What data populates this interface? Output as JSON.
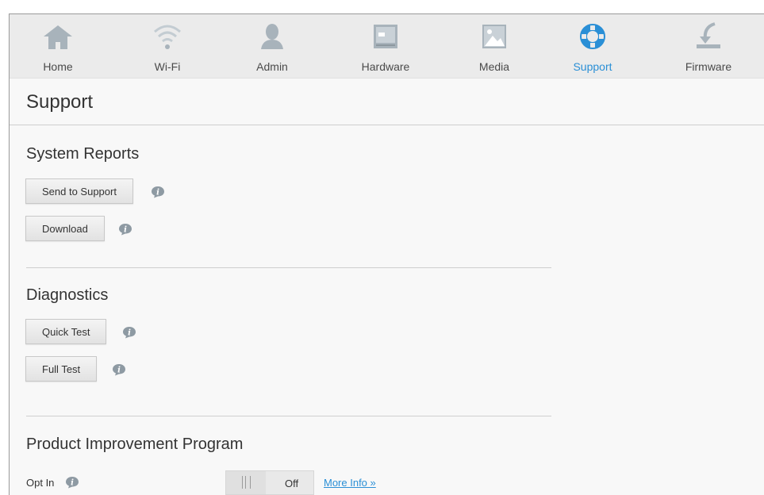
{
  "nav": {
    "items": [
      {
        "label": "Home",
        "icon": "home-icon"
      },
      {
        "label": "Wi-Fi",
        "icon": "wifi-icon"
      },
      {
        "label": "Admin",
        "icon": "admin-user-icon"
      },
      {
        "label": "Hardware",
        "icon": "hardware-icon"
      },
      {
        "label": "Media",
        "icon": "media-image-icon"
      },
      {
        "label": "Support",
        "icon": "lifebuoy-icon",
        "active": true
      },
      {
        "label": "Firmware",
        "icon": "firmware-download-icon"
      }
    ]
  },
  "page": {
    "title": "Support"
  },
  "system_reports": {
    "title": "System Reports",
    "send_label": "Send to Support",
    "download_label": "Download"
  },
  "diagnostics": {
    "title": "Diagnostics",
    "quick_label": "Quick Test",
    "full_label": "Full Test"
  },
  "product_improvement": {
    "title": "Product Improvement Program",
    "opt_in_label": "Opt In",
    "toggle_state": "Off",
    "more_info": "More Info »"
  },
  "colors": {
    "accent": "#2a8fd6",
    "icon_gray": "#a8b3bb",
    "info_icon": "#8e9aa3"
  }
}
